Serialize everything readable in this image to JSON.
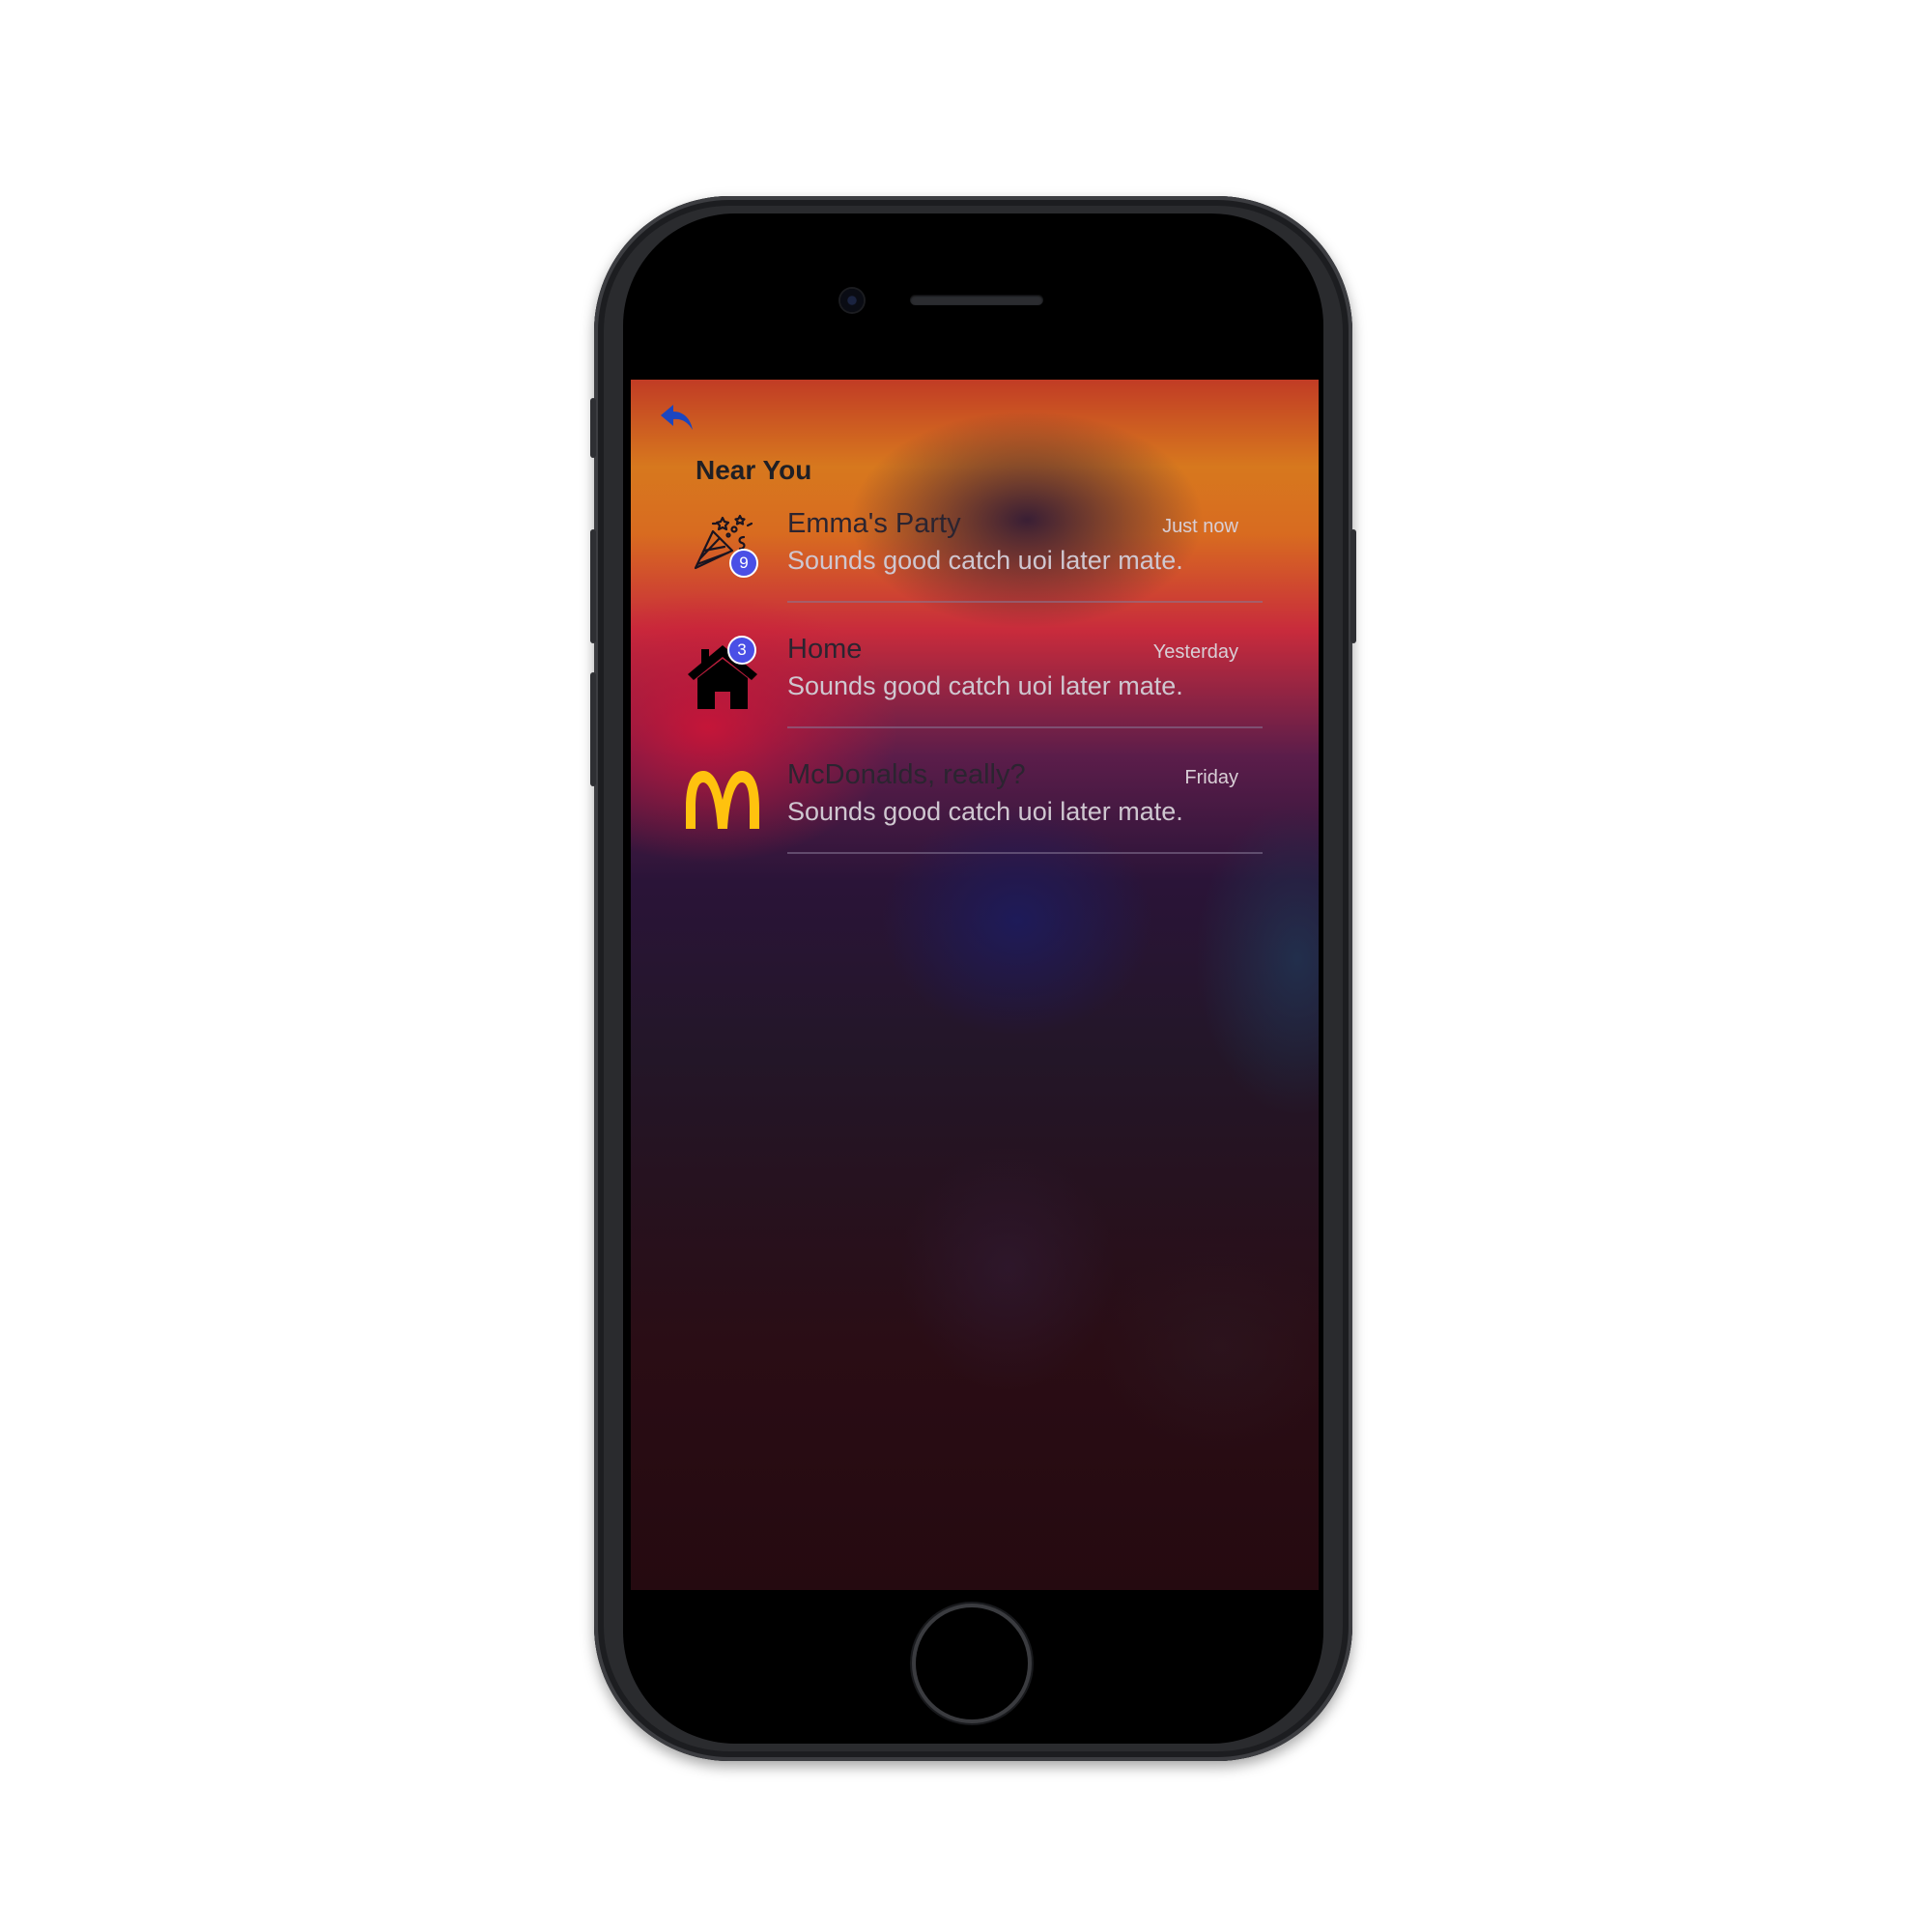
{
  "header": {
    "title": "Near You"
  },
  "colors": {
    "accent": "#1b46c0",
    "badge": "#4a4fe6",
    "logo_yellow": "#ffc20e"
  },
  "conversations": [
    {
      "title": "Emma's Party",
      "time": "Just now",
      "preview": "Sounds good catch uoi later mate.",
      "badge": "9",
      "icon": "party-popper-icon"
    },
    {
      "title": "Home",
      "time": "Yesterday",
      "preview": "Sounds good catch uoi later mate.",
      "badge": "3",
      "icon": "house-icon"
    },
    {
      "title": "McDonalds, really?",
      "time": "Friday",
      "preview": "Sounds good catch uoi later mate.",
      "icon": "mcdonalds-logo-icon"
    }
  ]
}
